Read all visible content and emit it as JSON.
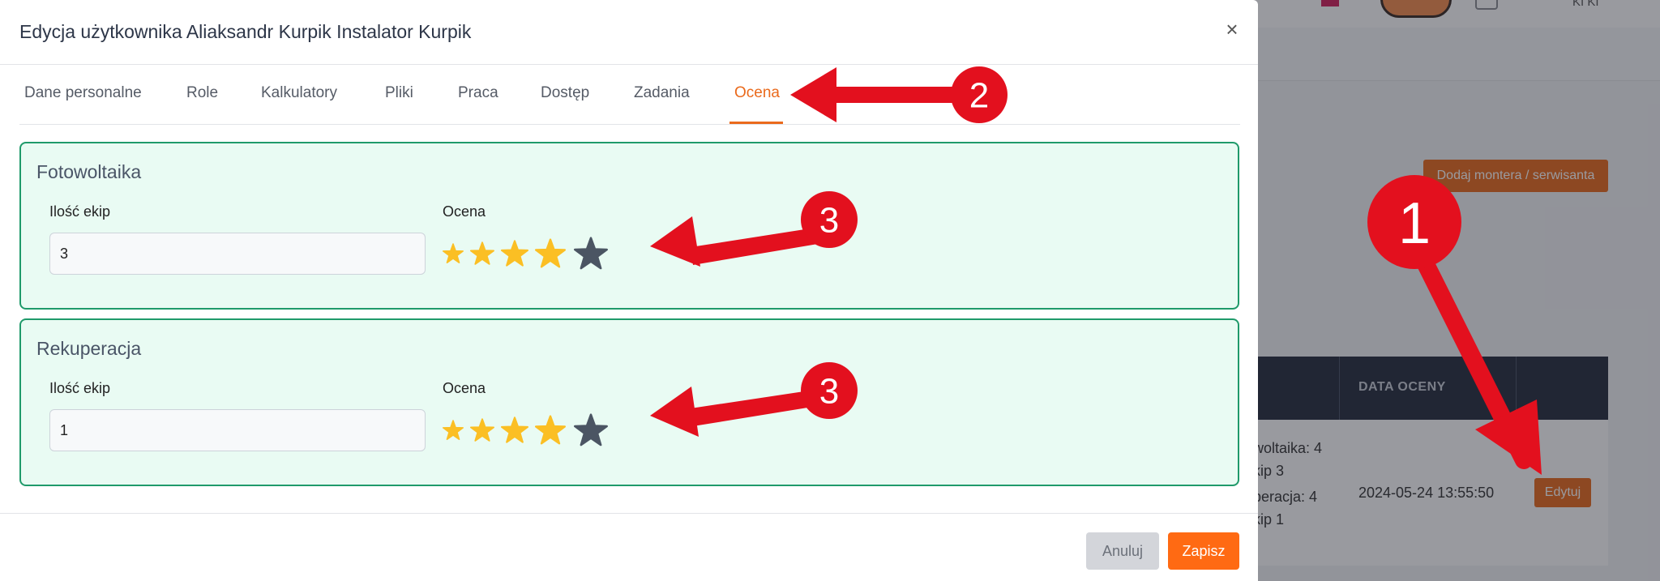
{
  "background": {
    "add_button_label": "Dodaj montera / serwisanta",
    "table_header": "DATA OCENY",
    "rating_lines": [
      "woltaika: 4",
      "kip 3",
      "peracja: 4",
      "kip 1"
    ],
    "date": "2024-05-24 13:55:50",
    "edit_button_label": "Edytuj",
    "user_label": "KI KI"
  },
  "modal": {
    "title": "Edycja użytkownika Aliaksandr Kurpik Instalator Kurpik",
    "close_glyph": "×",
    "tabs": [
      {
        "label": "Dane personalne"
      },
      {
        "label": "Role"
      },
      {
        "label": "Kalkulatory"
      },
      {
        "label": "Pliki"
      },
      {
        "label": "Praca"
      },
      {
        "label": "Dostęp"
      },
      {
        "label": "Zadania"
      },
      {
        "label": "Ocena",
        "active": true
      }
    ],
    "sections": [
      {
        "title": "Fotowoltaika",
        "teams_label": "Ilość ekip",
        "teams_value": "3",
        "rating_label": "Ocena",
        "rating": 4,
        "max_rating": 5
      },
      {
        "title": "Rekuperacja",
        "teams_label": "Ilość ekip",
        "teams_value": "1",
        "rating_label": "Ocena",
        "rating": 4,
        "max_rating": 5
      }
    ],
    "footer": {
      "cancel_label": "Anuluj",
      "save_label": "Zapisz"
    }
  },
  "annotations": {
    "markers": [
      "1",
      "2",
      "3",
      "3"
    ]
  },
  "colors": {
    "accent": "#ea6a1c",
    "panel_border": "#1f9a6a",
    "panel_bg": "#e9fbf3",
    "star_filled": "#fbbf24",
    "star_empty": "#4b5563",
    "annotation_red": "#e3101e"
  },
  "icons": {
    "close": "close-icon",
    "star": "star-icon"
  }
}
